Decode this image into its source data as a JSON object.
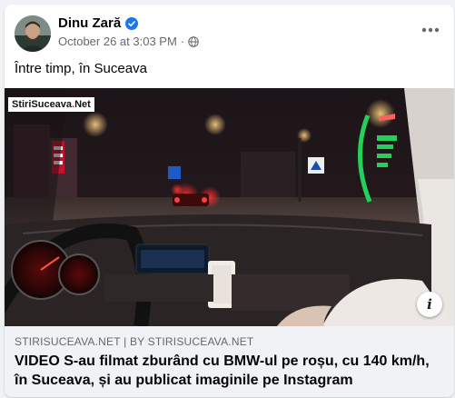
{
  "post": {
    "author": "Dinu Zară",
    "date": "October 26 at 3:03 PM",
    "separator": "·",
    "text": "Între timp, în Suceava",
    "audience_icon": "globe-icon",
    "verified_icon": "verified-badge-icon",
    "more_icon": "more-horizontal-icon"
  },
  "media": {
    "watermark_prefix": "StiriSuceava",
    "watermark_dot": ".",
    "watermark_suffix": "Net",
    "info_label": "i"
  },
  "link_preview": {
    "domain": "STIRISUCEAVA.NET | BY STIRISUCEAVA.NET",
    "headline": "VIDEO S-au filmat zburând cu BMW-ul pe roșu, cu 140 km/h, în Suceava, și au publicat imaginile pe Instagram"
  },
  "colors": {
    "accent": "#1877f2",
    "secondary_text": "#65676b",
    "primary_text": "#050505"
  }
}
